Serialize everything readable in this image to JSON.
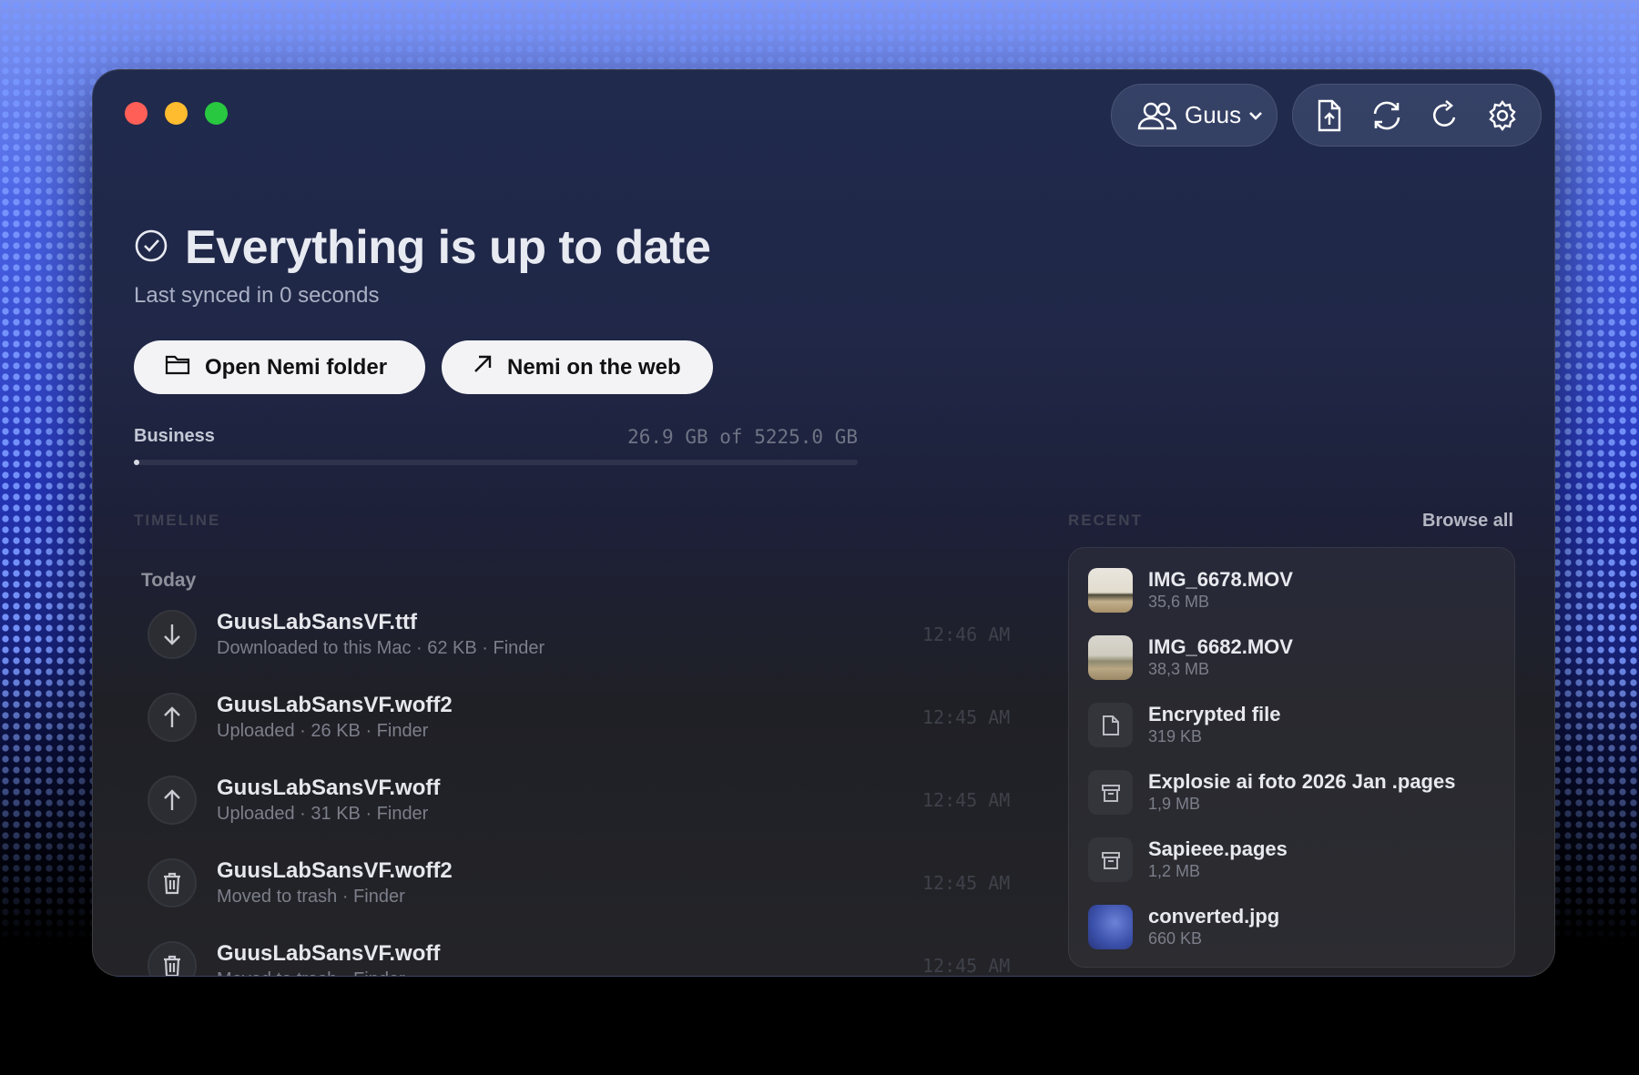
{
  "window": {
    "user": {
      "name": "Guus"
    },
    "toolbar": {
      "icons": [
        "file-upload-icon",
        "sync-icon",
        "refresh-icon",
        "gear-icon"
      ]
    }
  },
  "status": {
    "title": "Everything is up to date",
    "subtitle": "Last synced in 0 seconds"
  },
  "actions": {
    "open_folder": "Open Nemi folder",
    "web": "Nemi on the web"
  },
  "storage": {
    "plan": "Business",
    "usage": "26.9 GB of 5225.0 GB",
    "used_fraction": 0.0051
  },
  "timeline": {
    "label": "TIMELINE",
    "day": "Today",
    "items": [
      {
        "name": "GuusLabSansVF.ttf",
        "desc": "Downloaded to this Mac · 62 KB · Finder",
        "time": "12:46 AM",
        "icon": "download-arrow-icon"
      },
      {
        "name": "GuusLabSansVF.woff2",
        "desc": "Uploaded · 26 KB · Finder",
        "time": "12:45 AM",
        "icon": "upload-arrow-icon"
      },
      {
        "name": "GuusLabSansVF.woff",
        "desc": "Uploaded · 31 KB · Finder",
        "time": "12:45 AM",
        "icon": "upload-arrow-icon"
      },
      {
        "name": "GuusLabSansVF.woff2",
        "desc": "Moved to trash · Finder",
        "time": "12:45 AM",
        "icon": "trash-icon"
      },
      {
        "name": "GuusLabSansVF.woff",
        "desc": "Moved to trash · Finder",
        "time": "12:45 AM",
        "icon": "trash-icon"
      }
    ]
  },
  "recent": {
    "label": "RECENT",
    "browse_all": "Browse all",
    "items": [
      {
        "name": "IMG_6678.MOV",
        "size": "35,6 MB",
        "thumb": "desert-photo"
      },
      {
        "name": "IMG_6682.MOV",
        "size": "38,3 MB",
        "thumb": "desert-photo"
      },
      {
        "name": "Encrypted file",
        "size": "319 KB",
        "thumb": "document-icon"
      },
      {
        "name": "Explosie ai foto 2026 Jan .pages",
        "size": "1,9 MB",
        "thumb": "archive-icon"
      },
      {
        "name": "Sapieee.pages",
        "size": "1,2 MB",
        "thumb": "archive-icon"
      },
      {
        "name": "converted.jpg",
        "size": "660 KB",
        "thumb": "blue-image"
      }
    ]
  },
  "colors": {
    "accent_blue": "#4a63e6",
    "button_bg": "#f3f3f6",
    "traffic_red": "#ff5f57",
    "traffic_yellow": "#febc2e",
    "traffic_green": "#28c840"
  }
}
